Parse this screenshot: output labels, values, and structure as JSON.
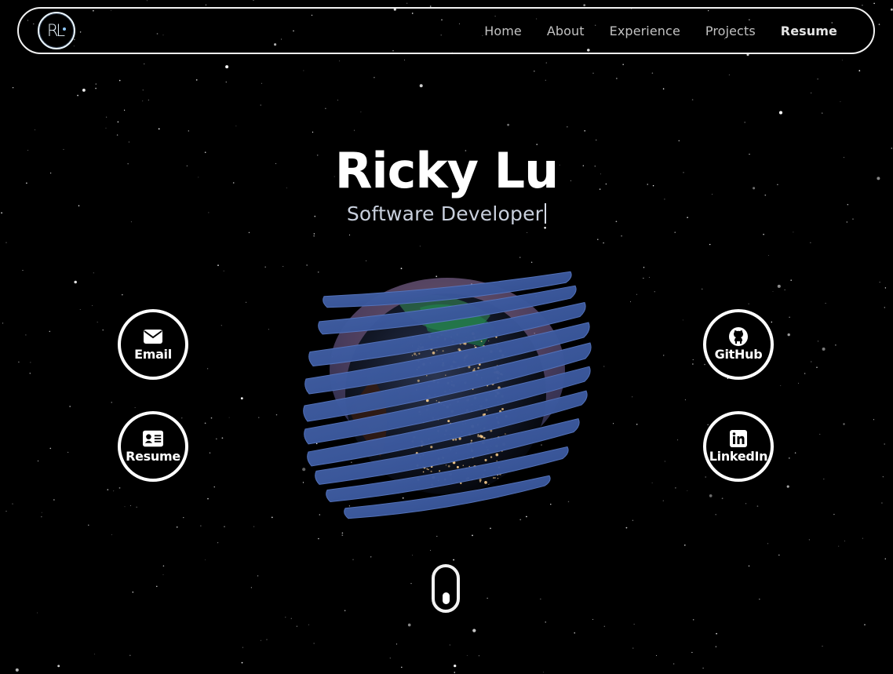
{
  "nav": {
    "logo_text": "RL",
    "links": [
      {
        "label": "Home"
      },
      {
        "label": "About"
      },
      {
        "label": "Experience"
      },
      {
        "label": "Projects"
      },
      {
        "label": "Resume"
      }
    ]
  },
  "hero": {
    "name": "Ricky Lu",
    "role": "Software Developer"
  },
  "contacts": {
    "email": {
      "label": "Email",
      "icon": "envelope-icon"
    },
    "resume": {
      "label": "Resume",
      "icon": "id-card-icon"
    },
    "github": {
      "label": "GitHub",
      "icon": "github-icon"
    },
    "linkedin": {
      "label": "LinkedIn",
      "icon": "linkedin-icon"
    }
  },
  "colors": {
    "background": "#000000",
    "text": "#ffffff",
    "nav_text": "#c2c2c2",
    "role_text": "#c8cfdc",
    "globe_ribbon": "#3f5ea6",
    "globe_highlight": "#9a7fb8"
  }
}
